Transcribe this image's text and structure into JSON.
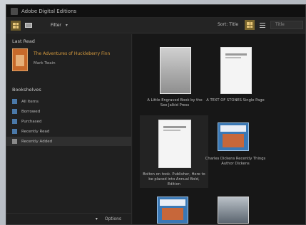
{
  "window": {
    "title": "Adobe Digital Editions"
  },
  "toolbar": {
    "filter_label": "Filter",
    "sort_label": "Sort: Title",
    "search_placeholder": "Title"
  },
  "sidebar": {
    "last_read_heading": "Last Read",
    "last_read_title": "The Adventures of Huckleberry Finn",
    "last_read_author": "Mark Twain",
    "bookshelves_heading": "Bookshelves",
    "shelves": [
      {
        "label": "All Items"
      },
      {
        "label": "Borrowed"
      },
      {
        "label": "Purchased"
      },
      {
        "label": "Recently Read"
      },
      {
        "label": "Recently Added"
      }
    ],
    "footer_label": "Options"
  },
  "books": [
    {
      "caption": "A Little Engraved Book by the See Jalkid Press"
    },
    {
      "caption": "A TEXT OF STONES Single Page"
    },
    {
      "caption": "Bolton on took. Publisher, Here to be placed into Annual Bold, Edition"
    },
    {
      "caption": "Charles Dickens Recently Things Author Dickens"
    },
    {
      "caption": ""
    },
    {
      "caption": ""
    }
  ],
  "colors": {
    "accent": "#d59a3e",
    "selected_view": "#7a662e",
    "window_bg": "#1b1b1b"
  }
}
